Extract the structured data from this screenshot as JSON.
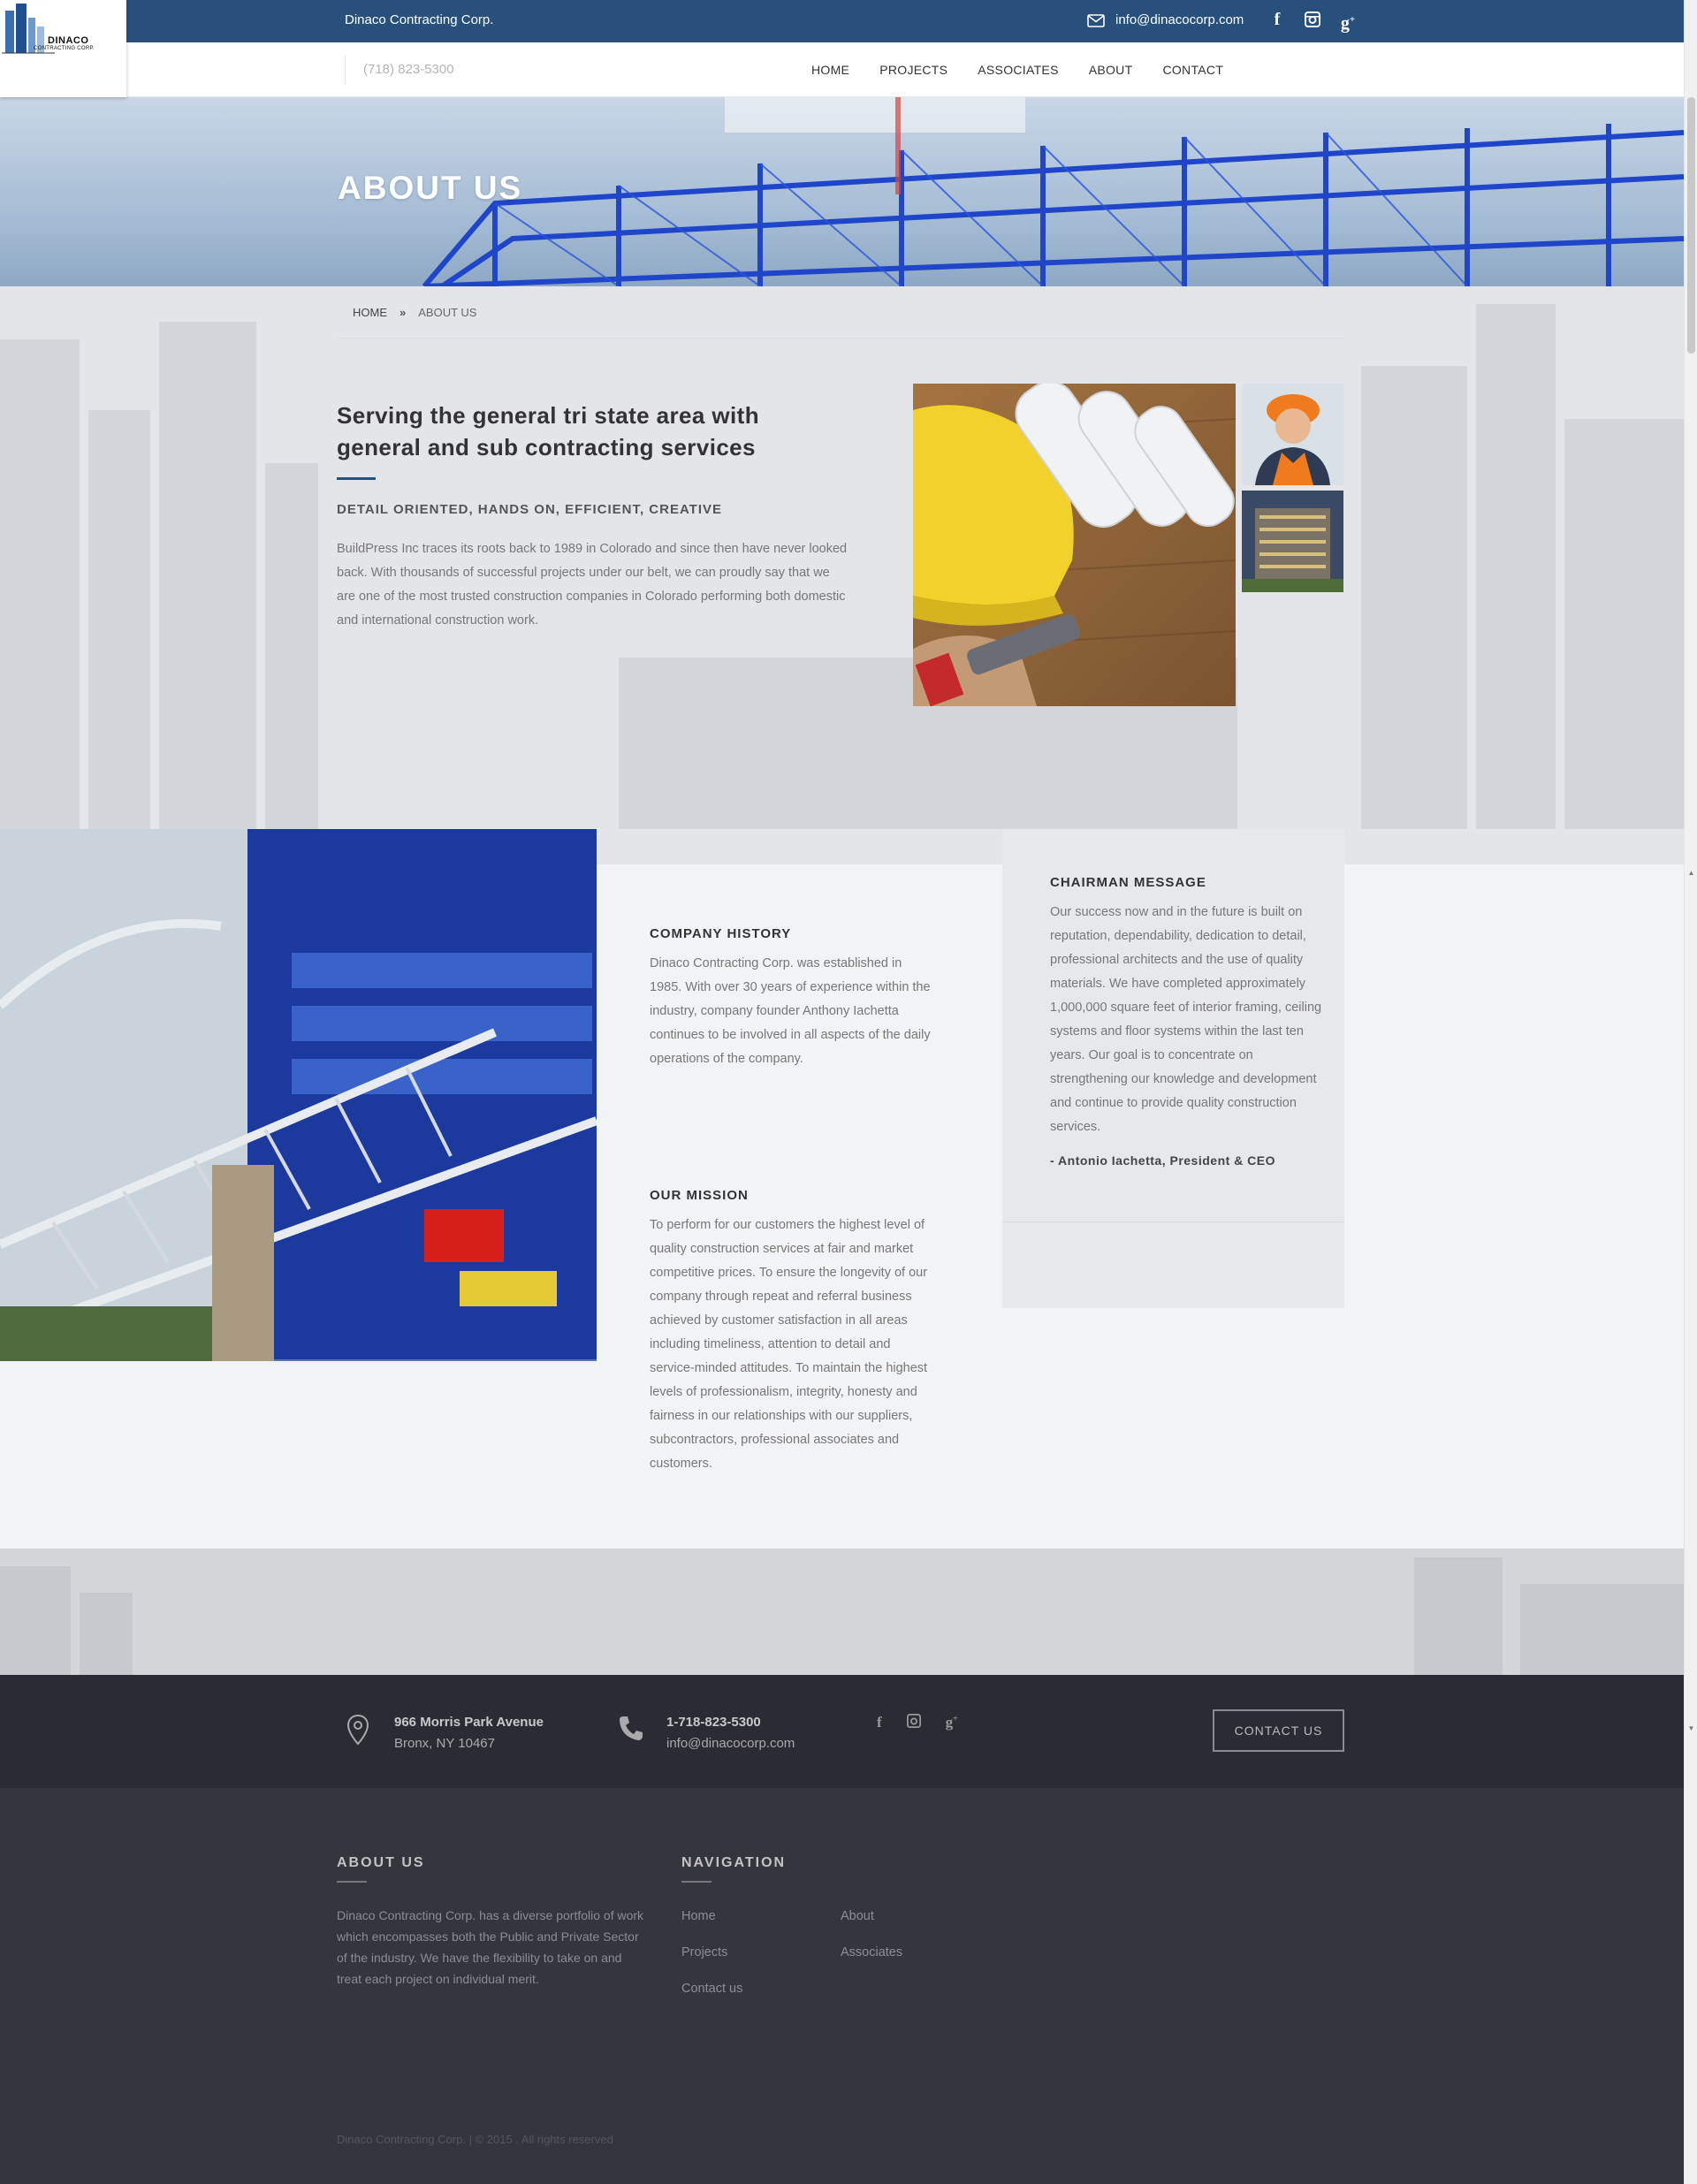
{
  "topbar": {
    "company": "Dinaco Contracting Corp.",
    "email": "info@dinacocorp.com",
    "social": [
      "facebook-icon",
      "instagram-icon",
      "google-plus-icon"
    ]
  },
  "logo": {
    "name": "DINACO",
    "subtitle": "CONTRACTING CORP."
  },
  "nav": {
    "phone": "(718) 823-5300",
    "items": [
      "HOME",
      "PROJECTS",
      "ASSOCIATES",
      "ABOUT",
      "CONTACT"
    ]
  },
  "hero": {
    "title": "ABOUT US"
  },
  "breadcrumb": {
    "home": "HOME",
    "separator": "»",
    "current": "ABOUT US"
  },
  "intro": {
    "title": "Serving the general tri state area with general and sub contracting services",
    "subtitle": "DETAIL ORIENTED, HANDS ON, EFFICIENT, CREATIVE",
    "text": "BuildPress Inc traces its roots back to 1989 in Colorado and since then have never looked back. With thousands of successful projects under our belt, we can proudly say that we are one of the most trusted construction companies in Colorado performing both domestic and international construction work."
  },
  "history": {
    "title": "COMPANY HISTORY",
    "text": "Dinaco Contracting Corp. was established in 1985. With over 30 years of experience within the industry, company founder Anthony Iachetta continues to be involved in all aspects of the daily operations of the company."
  },
  "mission": {
    "title": "OUR MISSION",
    "text": "To perform for our customers the highest level of quality construction services at fair and market competitive prices. To ensure the longevity of our company through repeat and referral business achieved by customer satisfaction in all areas including timeliness, attention to detail and service-minded attitudes. To maintain the highest levels of professionalism, integrity, honesty and fairness in our relationships with our suppliers, subcontractors, professional associates and customers."
  },
  "chairman": {
    "title": "CHAIRMAN MESSAGE",
    "text": "Our success now and in the future is built on reputation, dependability, dedication to detail, professional architects and the use of quality materials. We have completed approximately 1,000,000 square feet of interior framing, ceiling systems and floor systems within the last ten years. Our goal is to concentrate on strengthening our knowledge and development and continue to provide quality construction services.",
    "signature": "- Antonio Iachetta, President & CEO"
  },
  "contact_bar": {
    "address_line1": "966 Morris Park Avenue",
    "address_line2": "Bronx, NY 10467",
    "phone": "1-718-823-5300",
    "email": "info@dinacocorp.com",
    "button": "CONTACT US"
  },
  "footer": {
    "about_title": "ABOUT US",
    "about_text": "Dinaco Contracting Corp. has a diverse portfolio of work which encompasses both the Public and Private Sector of the industry. We have the flexibility to take on and treat each project on individual merit.",
    "nav_title": "NAVIGATION",
    "nav_links": [
      "Home",
      "About",
      "Projects",
      "Associates",
      "Contact us"
    ],
    "copyright": "Dinaco Contracting Corp. | © 2015 . All rights reserved"
  },
  "colors": {
    "brand": "#27507d",
    "footer": "#34353d",
    "contact_bar": "#2b2c33"
  }
}
